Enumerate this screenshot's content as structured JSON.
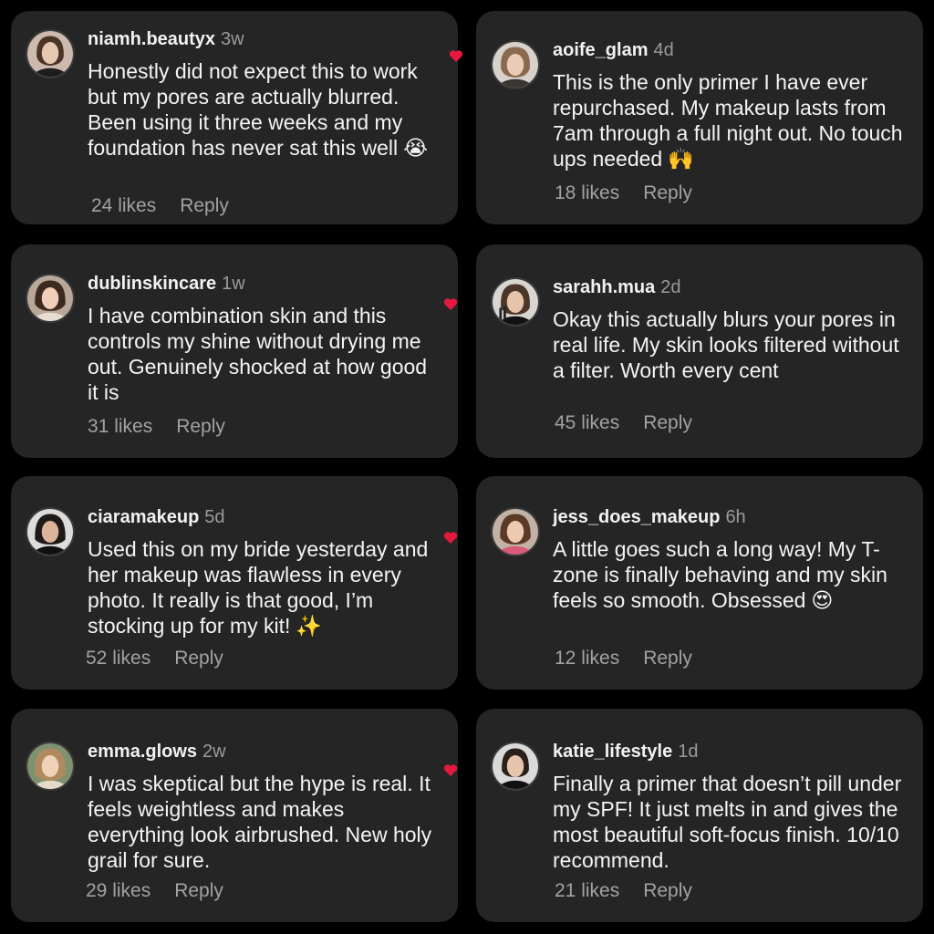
{
  "colors": {
    "background": "#000000",
    "card": "#252525",
    "text": "#f4f4f4",
    "muted": "#9b9b9b",
    "heart": "#e5193f"
  },
  "comments": [
    {
      "username": "niamh.beautyx",
      "time": "3w",
      "text": "Honestly did not expect this to work but my pores are actually blurred. Been using it three weeks and my foundation has never sat this well",
      "emoji": "😭",
      "likes": "24 likes",
      "reply": "Reply"
    },
    {
      "username": "aoife_glam",
      "time": "4d",
      "text": "This is the only primer I have ever repurchased. My makeup lasts from 7am through a full night out. No touch ups needed",
      "emoji": "🙌",
      "likes": "18 likes",
      "reply": "Reply"
    },
    {
      "username": "dublinskincare",
      "time": "1w",
      "text": "I have combination skin and this controls my shine without drying me out. Genuinely shocked at how good it is",
      "emoji": "",
      "likes": "31 likes",
      "reply": "Reply"
    },
    {
      "username": "sarahh.mua",
      "time": "2d",
      "text": "Okay this actually blurs your pores in real life. My skin looks filtered without a filter. Worth every cent",
      "emoji": "",
      "likes": "45 likes",
      "reply": "Reply"
    },
    {
      "username": "ciaramakeup",
      "time": "5d",
      "text": "Used this on my bride yesterday and her makeup was flawless in every photo. It really is that good, I’m stocking up for my kit!",
      "emoji": "✨",
      "likes": "52 likes",
      "reply": "Reply"
    },
    {
      "username": "jess_does_makeup",
      "time": "6h",
      "text": "A little goes such a long way! My T-zone is finally behaving and my skin feels so smooth. Obsessed",
      "emoji": "😍",
      "likes": "12 likes",
      "reply": "Reply"
    },
    {
      "username": "emma.glows",
      "time": "2w",
      "text": "I was skeptical but the hype is real. It feels weightless and makes everything look airbrushed. New holy grail for sure.",
      "emoji": "",
      "likes": "29 likes",
      "reply": "Reply"
    },
    {
      "username": "katie_lifestyle",
      "time": "1d",
      "text": "Finally a primer that doesn’t pill under my SPF! It just melts in and gives the most beautiful soft-focus finish. 10/10 recommend.",
      "emoji": "",
      "likes": "21 likes",
      "reply": "Reply"
    }
  ]
}
